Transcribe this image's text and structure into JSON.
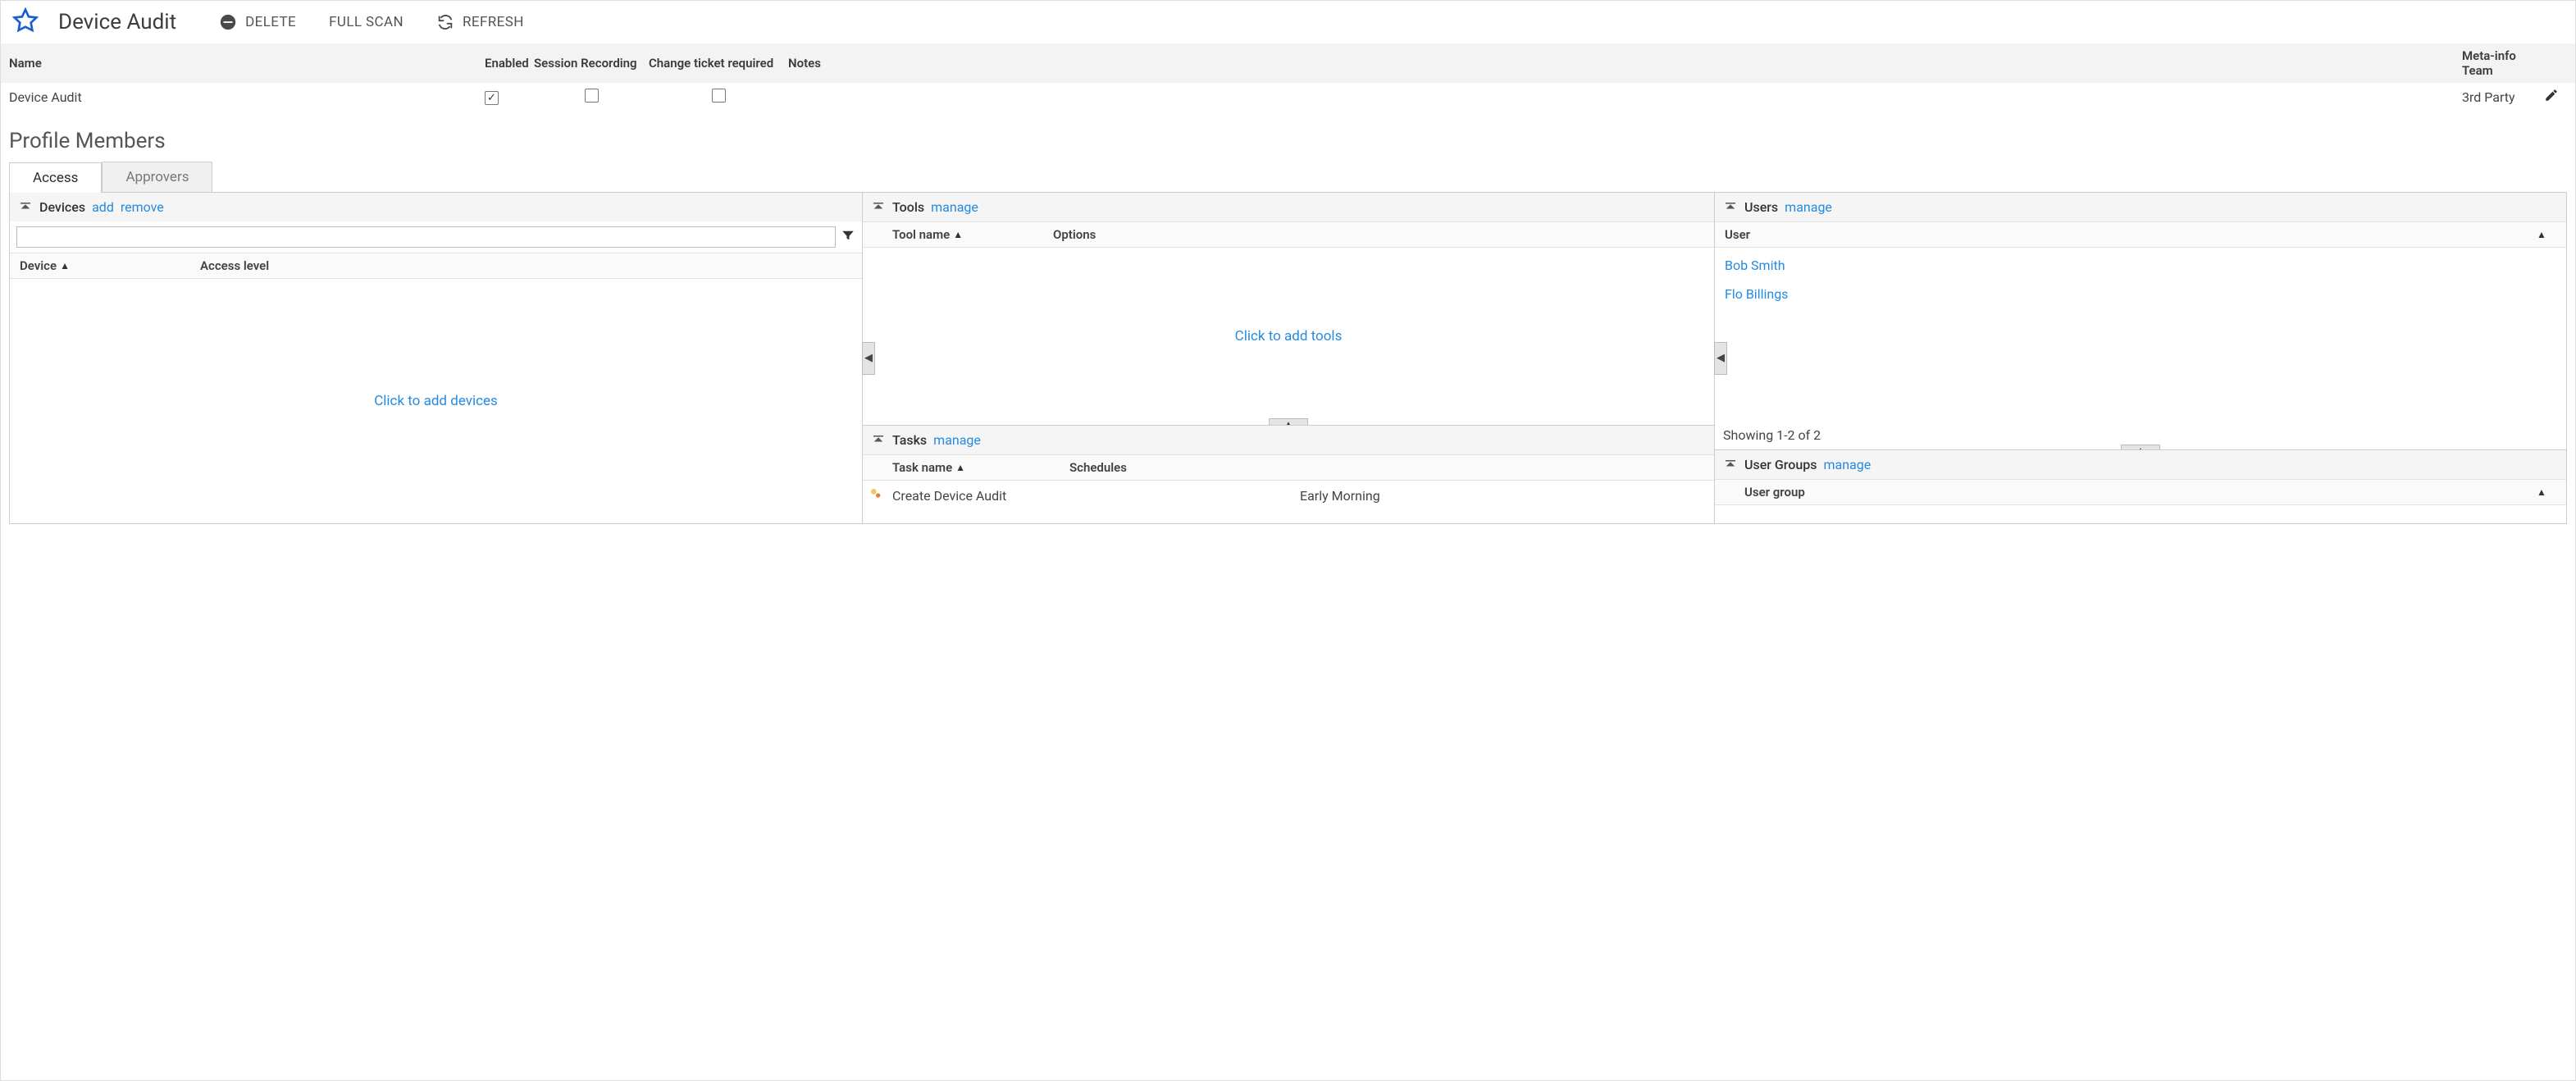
{
  "page": {
    "title": "Device Audit"
  },
  "topActions": {
    "delete": "DELETE",
    "fullScan": "FULL SCAN",
    "refresh": "REFRESH"
  },
  "overview": {
    "headers": {
      "name": "Name",
      "enabled": "Enabled",
      "sessionRecording": "Session Recording",
      "changeTicket": "Change ticket required",
      "notes": "Notes",
      "metaLine1": "Meta-info",
      "metaLine2": "Team"
    },
    "row": {
      "name": "Device Audit",
      "enabled": true,
      "sessionRecording": false,
      "changeTicket": false,
      "notes": "",
      "team": "3rd Party"
    }
  },
  "sectionTitle": "Profile Members",
  "tabs": {
    "access": "Access",
    "approvers": "Approvers"
  },
  "devices": {
    "title": "Devices",
    "addLink": "add",
    "removeLink": "remove",
    "searchPlaceholder": "",
    "cols": {
      "device": "Device",
      "access": "Access level"
    },
    "placeholder": "Click to add devices"
  },
  "tools": {
    "title": "Tools",
    "manage": "manage",
    "cols": {
      "name": "Tool name",
      "options": "Options"
    },
    "placeholder": "Click to add tools"
  },
  "tasks": {
    "title": "Tasks",
    "manage": "manage",
    "cols": {
      "name": "Task name",
      "schedules": "Schedules"
    },
    "rows": [
      {
        "name": "Create Device Audit",
        "schedule": "Early Morning"
      }
    ]
  },
  "users": {
    "title": "Users",
    "manage": "manage",
    "col": "User",
    "list": [
      "Bob Smith",
      "Flo Billings"
    ],
    "status": "Showing 1-2 of 2"
  },
  "userGroups": {
    "title": "User Groups",
    "manage": "manage",
    "col": "User group"
  }
}
